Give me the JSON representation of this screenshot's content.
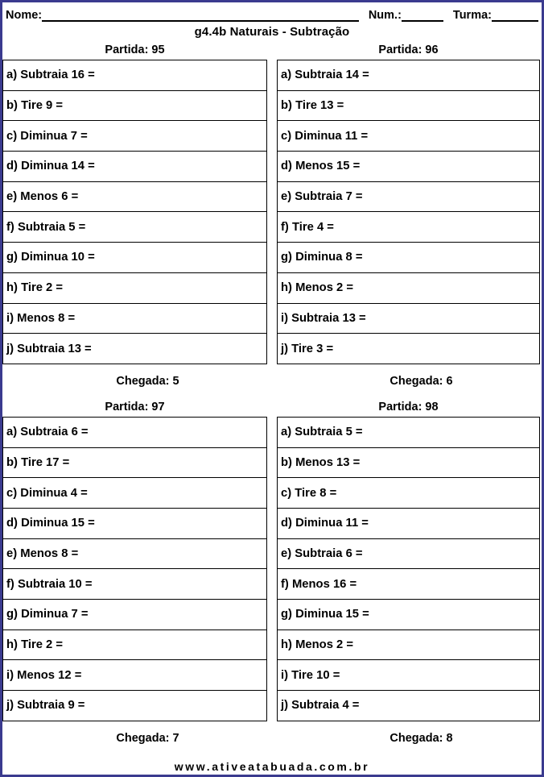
{
  "header": {
    "name_label": "Nome:",
    "num_label": "Num.:",
    "turma_label": "Turma:",
    "title": "g4.4b Naturais - Subtração"
  },
  "colors": {
    "page_border": "#3b3b8f",
    "table_border": "#000000",
    "text": "#000000"
  },
  "footer": {
    "url": "www.ativeatabuada.com.br"
  },
  "blocks": [
    {
      "columns": [
        {
          "partida_label": "Partida:",
          "partida_value": "95",
          "partida_text": "Partida: 95",
          "chegada_label": "Chegada:",
          "chegada_value": "5",
          "chegada_text": "Chegada: 5",
          "items": [
            "a) Subtraia 16 =",
            "b) Tire 9 =",
            "c) Diminua 7 =",
            "d) Diminua 14 =",
            "e) Menos 6 =",
            "f) Subtraia 5 =",
            "g) Diminua 10 =",
            "h) Tire 2 =",
            "i) Menos 8 =",
            "j) Subtraia 13 ="
          ]
        },
        {
          "partida_label": "Partida:",
          "partida_value": "96",
          "partida_text": "Partida: 96",
          "chegada_label": "Chegada:",
          "chegada_value": "6",
          "chegada_text": "Chegada: 6",
          "items": [
            "a) Subtraia 14 =",
            "b) Tire 13 =",
            "c) Diminua 11 =",
            "d) Menos 15 =",
            "e) Subtraia 7 =",
            "f) Tire 4 =",
            "g) Diminua 8 =",
            "h) Menos 2 =",
            "i) Subtraia 13 =",
            "j) Tire 3 ="
          ]
        }
      ]
    },
    {
      "columns": [
        {
          "partida_label": "Partida:",
          "partida_value": "97",
          "partida_text": "Partida: 97",
          "chegada_label": "Chegada:",
          "chegada_value": "7",
          "chegada_text": "Chegada: 7",
          "items": [
            "a) Subtraia 6 =",
            "b) Tire 17 =",
            "c) Diminua 4 =",
            "d) Diminua 15 =",
            "e) Menos 8 =",
            "f) Subtraia 10 =",
            "g) Diminua 7 =",
            "h) Tire 2 =",
            "i) Menos 12 =",
            "j) Subtraia 9 ="
          ]
        },
        {
          "partida_label": "Partida:",
          "partida_value": "98",
          "partida_text": "Partida: 98",
          "chegada_label": "Chegada:",
          "chegada_value": "8",
          "chegada_text": "Chegada: 8",
          "items": [
            "a) Subtraia 5 =",
            "b) Menos 13 =",
            "c) Tire 8 =",
            "d) Diminua 11 =",
            "e) Subtraia 6 =",
            "f) Menos 16 =",
            "g) Diminua 15 =",
            "h) Menos 2 =",
            "i) Tire 10 =",
            "j) Subtraia 4 ="
          ]
        }
      ]
    }
  ]
}
